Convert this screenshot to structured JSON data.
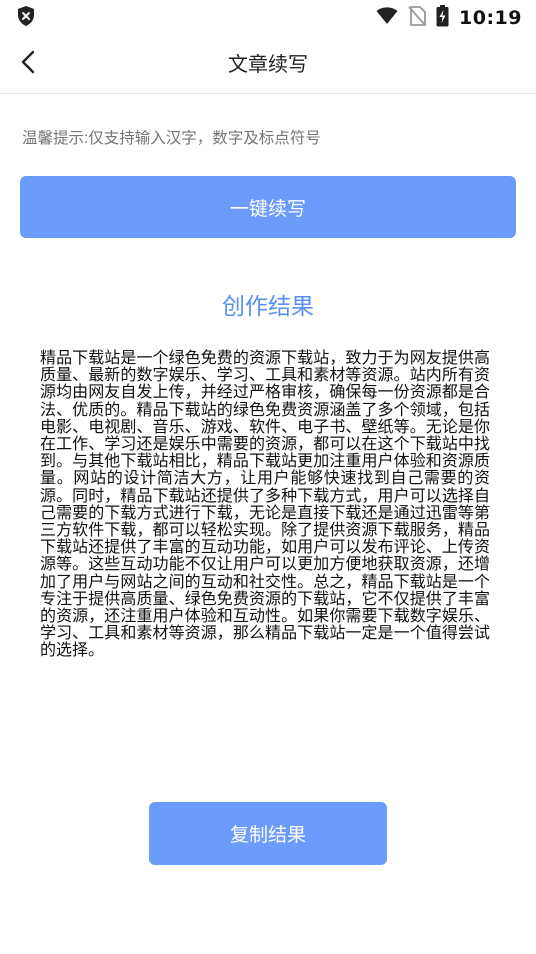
{
  "status_bar": {
    "time": "10:19",
    "icons": [
      "shield-x-icon",
      "wifi-icon",
      "no-sim-icon",
      "battery-charging-icon"
    ]
  },
  "nav": {
    "back_icon": "chevron-left-icon",
    "title": "文章续写"
  },
  "input": {
    "placeholder": "温馨提示:仅支持输入汉字，数字及标点符号"
  },
  "generate_button": {
    "label": "一键续写"
  },
  "result": {
    "heading": "创作结果",
    "text": "精品下载站是一个绿色免费的资源下载站，致力于为网友提供高质量、最新的数字娱乐、学习、工具和素材等资源。站内所有资源均由网友自发上传，并经过严格审核，确保每一份资源都是合法、优质的。精品下载站的绿色免费资源涵盖了多个领域，包括电影、电视剧、音乐、游戏、软件、电子书、壁纸等。无论是你在工作、学习还是娱乐中需要的资源，都可以在这个下载站中找到。与其他下载站相比，精品下载站更加注重用户体验和资源质量。网站的设计简洁大方，让用户能够快速找到自己需要的资源。同时，精品下载站还提供了多种下载方式，用户可以选择自己需要的下载方式进行下载，无论是直接下载还是通过迅雷等第三方软件下载，都可以轻松实现。除了提供资源下载服务，精品下载站还提供了丰富的互动功能，如用户可以发布评论、上传资源等。这些互动功能不仅让用户可以更加方便地获取资源，还增加了用户与网站之间的互动和社交性。总之，精品下载站是一个专注于提供高质量、绿色免费资源的下载站，它不仅提供了丰富的资源，还注重用户体验和互动性。如果你需要下载数字娱乐、学习、工具和素材等资源，那么精品下载站一定是一个值得尝试的选择。"
  },
  "copy_button": {
    "label": "复制结果"
  },
  "colors": {
    "accent": "#6b9cfb",
    "heading": "#5b8ff2",
    "hint": "#a6a6a6"
  }
}
